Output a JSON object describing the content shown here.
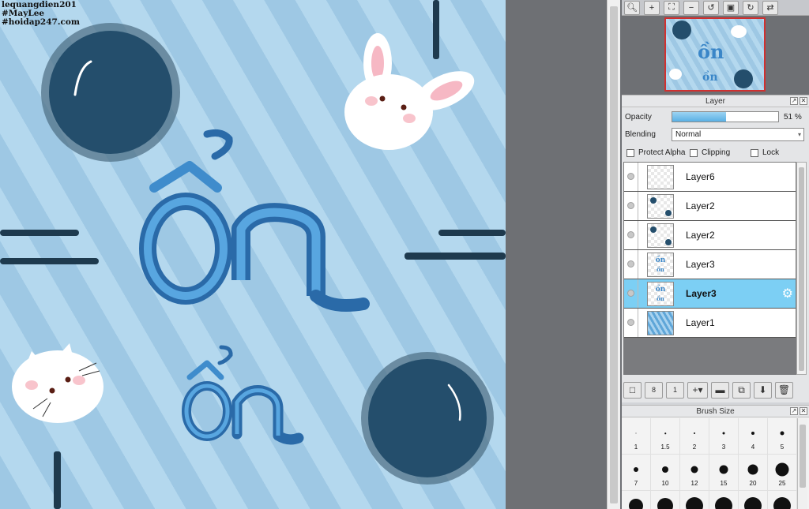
{
  "canvas": {
    "watermark": [
      "lequangdien201",
      "#MayLee",
      "#hoidap247.com"
    ],
    "lettering_main": "ồn",
    "lettering_small": "ồn"
  },
  "toolbar": {
    "icons": [
      "zoom-reset-icon",
      "zoom-in-icon",
      "fit-view-icon",
      "zoom-out-icon",
      "rotate-left-icon",
      "fit-window-icon",
      "rotate-right-icon",
      "flip-icon"
    ]
  },
  "layer_panel": {
    "title": "Layer",
    "opacity_label": "Opacity",
    "opacity_value": 51,
    "opacity_text": "51 %",
    "blending_label": "Blending",
    "blending_value": "Normal",
    "checkboxes": {
      "protect_alpha": "Protect Alpha",
      "clipping": "Clipping",
      "lock": "Lock"
    },
    "layers": [
      {
        "name": "Layer6",
        "selected": false,
        "thumb": "empty"
      },
      {
        "name": "Layer2",
        "selected": false,
        "thumb": "dots"
      },
      {
        "name": "Layer2",
        "selected": false,
        "thumb": "dots"
      },
      {
        "name": "Layer3",
        "selected": false,
        "thumb": "text"
      },
      {
        "name": "Layer3",
        "selected": true,
        "thumb": "text"
      },
      {
        "name": "Layer1",
        "selected": false,
        "thumb": "stripes"
      }
    ],
    "toolbar_icons": [
      "new-layer-icon",
      "new-layer-8bit-icon",
      "new-layer-1bit-icon",
      "add-layer-menu-icon",
      "new-folder-icon",
      "duplicate-layer-icon",
      "merge-down-icon",
      "delete-layer-icon"
    ]
  },
  "brush_panel": {
    "title": "Brush Size",
    "sizes": [
      "1",
      "1.5",
      "2",
      "3",
      "4",
      "5",
      "7",
      "10",
      "12",
      "15",
      "20",
      "25",
      "",
      "",
      "",
      "",
      "",
      ""
    ]
  },
  "colors": {
    "selected_layer": "#7ccff4",
    "canvas_stripe_dark": "#9ec8e4",
    "canvas_stripe_light": "#b4d8ee",
    "orb": "#244e6c",
    "lettering": "#3a86c8"
  }
}
